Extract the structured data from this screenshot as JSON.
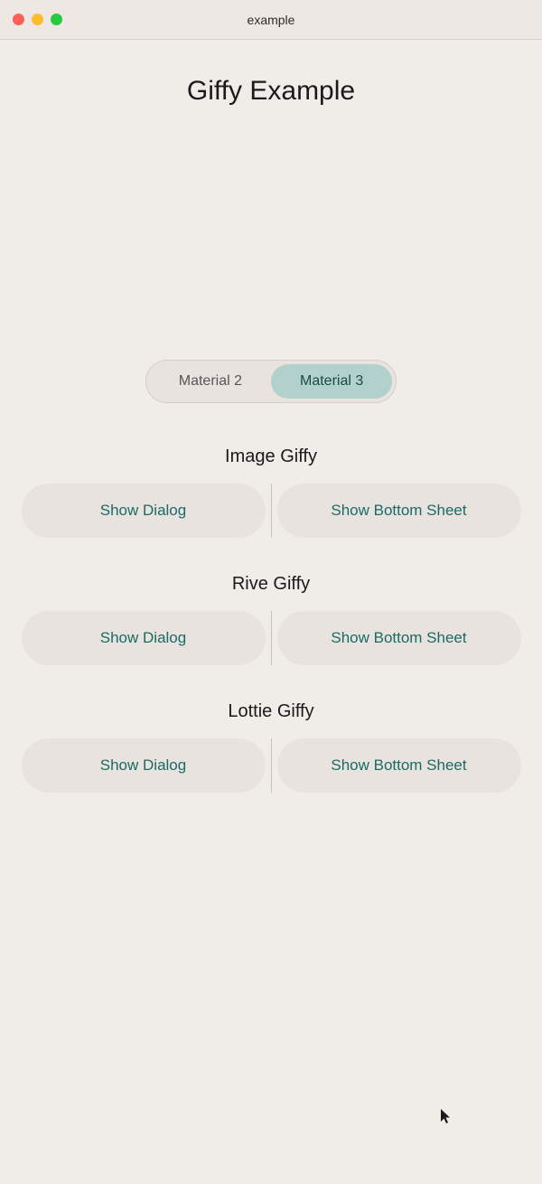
{
  "titlebar": {
    "title": "example",
    "controls": {
      "close_label": "close",
      "minimize_label": "minimize",
      "maximize_label": "maximize"
    }
  },
  "page": {
    "title": "Giffy Example"
  },
  "toggle": {
    "option1_label": "Material 2",
    "option2_label": "Material 3",
    "active": "option2"
  },
  "sections": [
    {
      "id": "image-giffy",
      "title": "Image Giffy",
      "show_dialog_label": "Show Dialog",
      "show_bottom_sheet_label": "Show Bottom Sheet"
    },
    {
      "id": "rive-giffy",
      "title": "Rive Giffy",
      "show_dialog_label": "Show Dialog",
      "show_bottom_sheet_label": "Show Bottom Sheet"
    },
    {
      "id": "lottie-giffy",
      "title": "Lottie Giffy",
      "show_dialog_label": "Show Dialog",
      "show_bottom_sheet_label": "Show Bottom Sheet"
    }
  ],
  "colors": {
    "button_text": "#1a6b63",
    "active_toggle_bg": "#b2d0cc",
    "button_bg": "#e8e3de",
    "bg": "#f0ece8"
  }
}
